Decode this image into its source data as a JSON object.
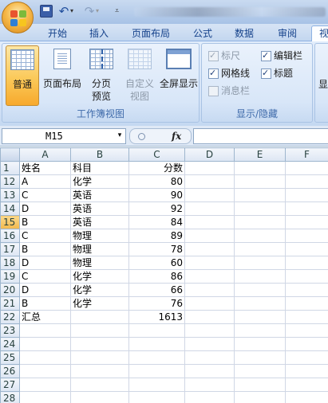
{
  "quick_access": {
    "undo_glyph": "↶",
    "redo_glyph": "↷",
    "dropdown_glyph": "▾",
    "customize_glyph": "⩡"
  },
  "tabs": {
    "home": "开始",
    "insert": "插入",
    "page_layout": "页面布局",
    "formulas": "公式",
    "data": "数据",
    "review": "审阅",
    "view": "视"
  },
  "ribbon": {
    "workbook_views": {
      "group_label": "工作簿视图",
      "normal": "普通",
      "page_layout": "页面布局",
      "page_break_preview_line1": "分页",
      "page_break_preview_line2": "预览",
      "custom_views_line1": "自定义",
      "custom_views_line2": "视图",
      "full_screen": "全屏显示"
    },
    "show_hide": {
      "group_label": "显示/隐藏",
      "ruler": "标尺",
      "formula_bar": "编辑栏",
      "gridlines": "网格线",
      "headings": "标题",
      "message_bar": "消息栏"
    },
    "zoom": {
      "fragment": "显"
    }
  },
  "formula_bar": {
    "name_box": "M15",
    "dropdown_glyph": "▾",
    "fx": "fx",
    "formula": ""
  },
  "sheet": {
    "columns": [
      "A",
      "B",
      "C",
      "D",
      "E",
      "F"
    ],
    "rows": [
      {
        "n": "1",
        "a": "姓名",
        "b": "科目",
        "c": "分数"
      },
      {
        "n": "12",
        "a": "A",
        "b": "化学",
        "c": "80"
      },
      {
        "n": "13",
        "a": "C",
        "b": "英语",
        "c": "90"
      },
      {
        "n": "14",
        "a": "D",
        "b": "英语",
        "c": "92"
      },
      {
        "n": "15",
        "a": "B",
        "b": "英语",
        "c": "84"
      },
      {
        "n": "16",
        "a": "C",
        "b": "物理",
        "c": "89"
      },
      {
        "n": "17",
        "a": "B",
        "b": "物理",
        "c": "78"
      },
      {
        "n": "18",
        "a": "D",
        "b": "物理",
        "c": "60"
      },
      {
        "n": "19",
        "a": "C",
        "b": "化学",
        "c": "86"
      },
      {
        "n": "20",
        "a": "D",
        "b": "化学",
        "c": "66"
      },
      {
        "n": "21",
        "a": "B",
        "b": "化学",
        "c": "76"
      },
      {
        "n": "22",
        "a": "汇总",
        "b": "",
        "c": "1613"
      },
      {
        "n": "23",
        "a": "",
        "b": "",
        "c": ""
      },
      {
        "n": "24",
        "a": "",
        "b": "",
        "c": ""
      },
      {
        "n": "25",
        "a": "",
        "b": "",
        "c": ""
      },
      {
        "n": "26",
        "a": "",
        "b": "",
        "c": ""
      },
      {
        "n": "27",
        "a": "",
        "b": "",
        "c": ""
      },
      {
        "n": "28",
        "a": "",
        "b": "",
        "c": ""
      }
    ]
  },
  "colors": {
    "ribbon_bg": "#dbe6f6",
    "tab_text": "#15428b",
    "group_label": "#3e6aaa",
    "active_button": "#fbc959",
    "header_border": "#9eb6ce"
  }
}
